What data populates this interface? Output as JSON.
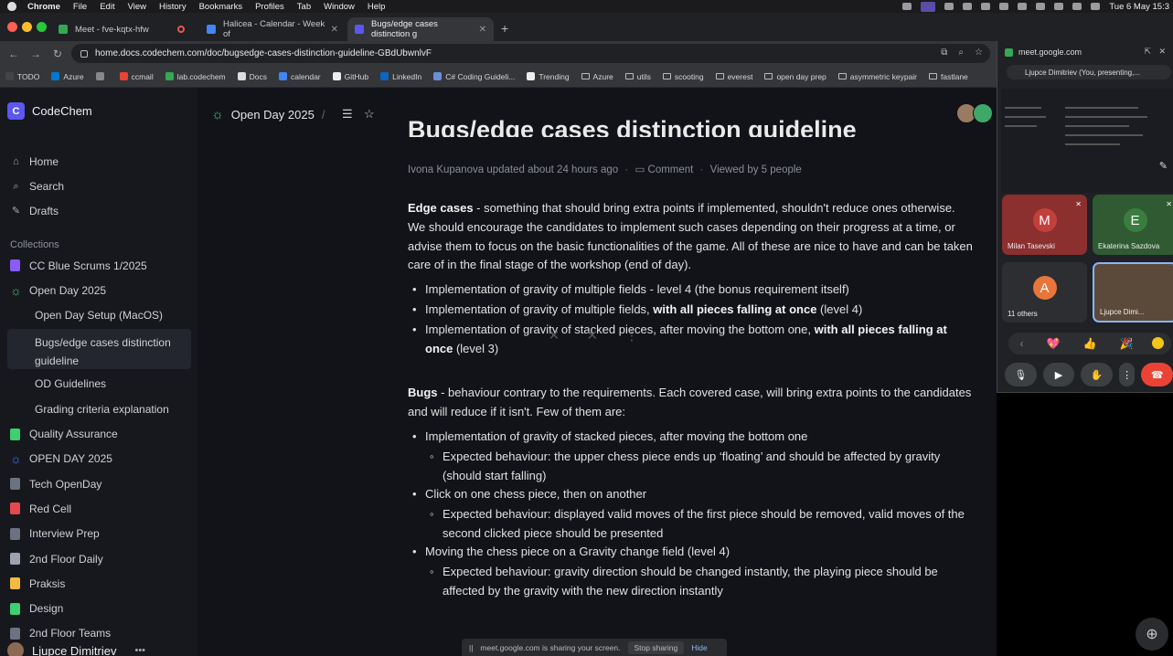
{
  "menubar": {
    "items": [
      "Chrome",
      "File",
      "Edit",
      "View",
      "History",
      "Bookmarks",
      "Profiles",
      "Tab",
      "Window",
      "Help"
    ],
    "clock": "Tue 6 May  15:3"
  },
  "tabs": [
    {
      "title": "Meet - fve-kqtx-hfw",
      "favicon_color": "#34a853",
      "active": false
    },
    {
      "title": "Halicea - Calendar - Week of",
      "favicon_color": "#4285f4",
      "active": false
    },
    {
      "title": "Bugs/edge cases distinction g",
      "favicon_color": "#5b57f0",
      "active": true
    }
  ],
  "toolbar": {
    "url": "home.docs.codechem.com/doc/bugsedge-cases-distinction-guideline-GBdUbwnlvF"
  },
  "bookmarks": [
    {
      "label": "TODO",
      "color": "#444"
    },
    {
      "label": "Azure",
      "color": "#0078d4"
    },
    {
      "label": "",
      "color": "#888"
    },
    {
      "label": "ccmail",
      "color": "#ea4335"
    },
    {
      "label": "lab.codechem",
      "color": "#34a853"
    },
    {
      "label": "Docs",
      "color": "#ddd"
    },
    {
      "label": "calendar",
      "color": "#4285f4"
    },
    {
      "label": "GitHub",
      "color": "#eee"
    },
    {
      "label": "LinkedIn",
      "color": "#0a66c2"
    },
    {
      "label": "C# Coding Guideli...",
      "color": "#6a8fd6"
    },
    {
      "label": "Trending",
      "color": "#eee"
    },
    {
      "label": "Azure",
      "color": "folder"
    },
    {
      "label": "utils",
      "color": "folder"
    },
    {
      "label": "scooting",
      "color": "folder"
    },
    {
      "label": "everest",
      "color": "folder"
    },
    {
      "label": "open day prep",
      "color": "folder"
    },
    {
      "label": "asymmetric keypair",
      "color": "folder"
    },
    {
      "label": "fastlane",
      "color": "folder"
    }
  ],
  "sidebar": {
    "workspace": {
      "logo": "C",
      "name": "CodeChem"
    },
    "nav": [
      {
        "label": "Home",
        "icon": "house-icon",
        "glyph": "⌂"
      },
      {
        "label": "Search",
        "icon": "search-icon",
        "glyph": "⌕"
      },
      {
        "label": "Drafts",
        "icon": "pencil-icon",
        "glyph": "✎"
      }
    ],
    "collections_label": "Collections",
    "collections": [
      {
        "label": "CC Blue Scrums 1/2025",
        "color": "#8a5cf6",
        "child": false,
        "selected": false
      },
      {
        "label": "Open Day 2025",
        "color": "#3ecf6f",
        "child": false,
        "selected": false,
        "sun": true
      },
      {
        "label": "Open Day Setup (MacOS)",
        "color": "",
        "child": true,
        "selected": false
      },
      {
        "label": "Bugs/edge cases distinction guideline",
        "color": "",
        "child": true,
        "selected": true
      },
      {
        "label": "OD Guidelines",
        "color": "",
        "child": true,
        "selected": false
      },
      {
        "label": "Grading criteria explanation",
        "color": "",
        "child": true,
        "selected": false
      },
      {
        "label": "Quality Assurance",
        "color": "#3ecf6f",
        "child": false,
        "selected": false
      },
      {
        "label": "OPEN DAY 2025",
        "color": "#4a7cff",
        "child": false,
        "selected": false,
        "sun": true
      },
      {
        "label": "Tech OpenDay",
        "color": "#6b7280",
        "child": false,
        "selected": false
      },
      {
        "label": "Red Cell",
        "color": "#e5484d",
        "child": false,
        "selected": false
      },
      {
        "label": "Interview Prep",
        "color": "#6b7280",
        "child": false,
        "selected": false
      },
      {
        "label": "2nd Floor Daily",
        "color": "#9ca3af",
        "child": false,
        "selected": false
      },
      {
        "label": "Praksis",
        "color": "#f5b942",
        "child": false,
        "selected": false
      },
      {
        "label": "Design",
        "color": "#3ecf6f",
        "child": false,
        "selected": false
      },
      {
        "label": "2nd Floor Teams",
        "color": "#6b7280",
        "child": false,
        "selected": false
      }
    ],
    "user": "Ljupce Dimitriev"
  },
  "header": {
    "breadcrumb": "Open Day 2025",
    "separator": "/"
  },
  "doc": {
    "title": "Bugs/edge cases distinction guideline",
    "meta_author": "Ivona Kupanova updated about 24 hours ago",
    "meta_comment": "Comment",
    "meta_viewed": "Viewed by 5 people",
    "edge_heading": "Edge cases",
    "edge_text": " - something that should bring extra points if implemented, shouldn't reduce ones otherwise. We should encourage the candidates to implement such cases depending on their progress at a time, or advise them to focus on the basic functionalities of the game. All of these are nice to have and can be taken care of in the final stage of the workshop (end of day).",
    "edge_items": [
      {
        "a": "Implementation of gravity of multiple fields - level 4 (the bonus requirement itself)",
        "b": "",
        "c": ""
      },
      {
        "a": "Implementation of gravity of multiple fields, ",
        "b": "with all pieces falling at once",
        "c": " (level 4)"
      },
      {
        "a": "Implementation of gravity of stacked pieces, after moving the bottom one, ",
        "b": "with all pieces falling at once",
        "c": " (level 3)"
      }
    ],
    "bugs_heading": "Bugs",
    "bugs_text": " - behaviour contrary to the requirements. Each covered case, will bring extra points to the candidates and will reduce if it isn't. Few of them are:",
    "bug_items": [
      "Implementation of gravity of stacked pieces, after moving the bottom one",
      "Expected behaviour: the upper chess piece ends up ‘floating’ and should be affected by gravity (should start falling)",
      "Click on one chess piece, then on another",
      "Expected behaviour: displayed valid moves of the first piece should be removed, valid moves of the second clicked piece should be presented",
      "Moving the chess piece on a Gravity change field (level 4)",
      "Expected behaviour: gravity direction should be changed instantly, the playing piece should be affected by the gravity with the new direction instantly"
    ]
  },
  "sharebar": {
    "text": "meet.google.com is sharing your screen.",
    "stop": "Stop sharing",
    "hide": "Hide"
  },
  "meet": {
    "url": "meet.google.com",
    "presenting": "Ljupce Dimitriev (You, presenting,...",
    "tiles": [
      {
        "initial": "M",
        "name": "Milan Tasevski",
        "bg": "#8b2f2f",
        "avatar": "#c2403c"
      },
      {
        "initial": "E",
        "name": "Ekaterina Sazdova",
        "bg": "#2f5a32",
        "avatar": "#3b7d3f"
      },
      {
        "initial": "A",
        "name": "11 others",
        "bg": "#2d2e31",
        "avatar": "#e8763a"
      },
      {
        "initial": "",
        "name": "Ljupce Dimi...",
        "bg": "#5b4a3a",
        "avatar": ""
      }
    ],
    "reactions": [
      "💖",
      "👍",
      "🎉"
    ]
  }
}
